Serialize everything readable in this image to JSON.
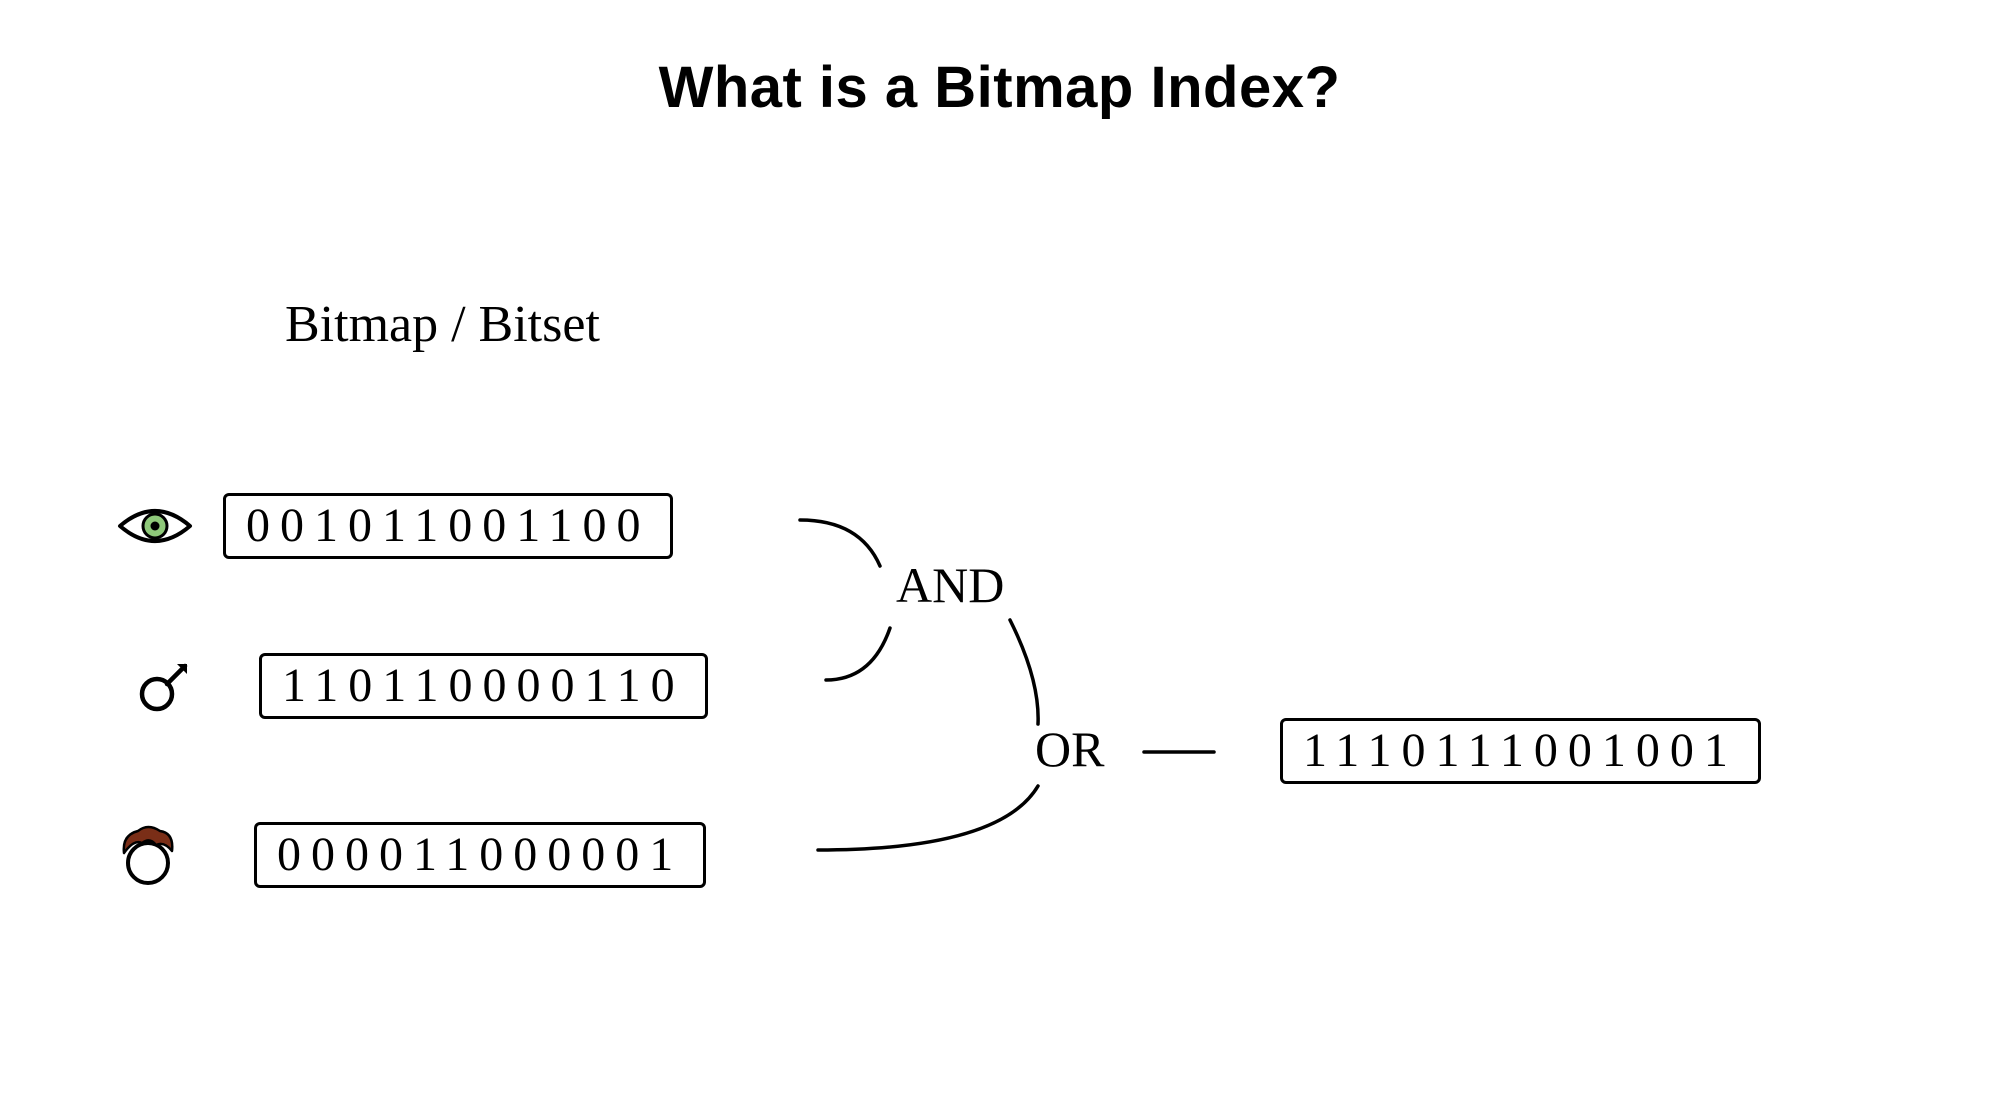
{
  "title": "What is a Bitmap Index?",
  "subtitle": "Bitmap / Bitset",
  "rows": {
    "eye": {
      "bits": "001011001100",
      "icon": "green-eye"
    },
    "male": {
      "bits": "110110000110",
      "icon": "male-symbol"
    },
    "hair": {
      "bits": "000011000001",
      "icon": "red-hair-head"
    },
    "result": {
      "bits": "1110111001001"
    }
  },
  "operators": {
    "and": "AND",
    "or": "OR"
  }
}
